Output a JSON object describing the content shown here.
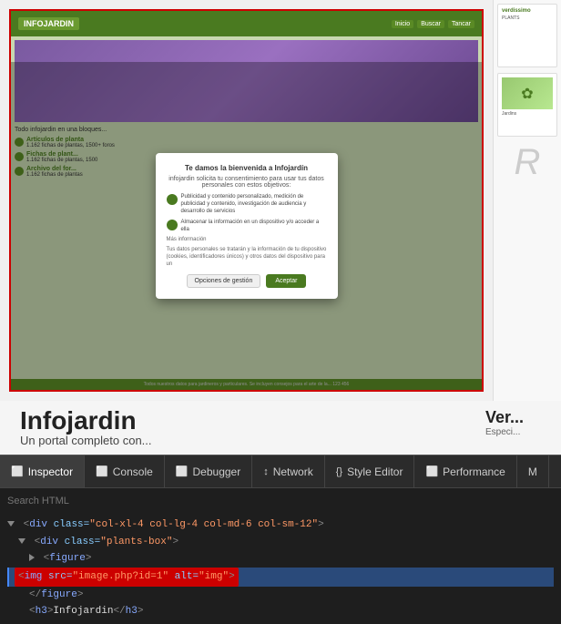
{
  "top_area": {
    "browser_frame": {
      "header": {
        "logo": "INFOJARDIN",
        "nav_items": [
          "Inicio",
          "Buscar",
          "Tancar"
        ]
      },
      "modal": {
        "title": "Te damos la bienvenida a Infojardín",
        "subtitle": "infojardin solicita tu consentimiento para usar tus datos personales con estos objetivos:",
        "option1": "Publicidad y contenido personalizado, medición de publicidad y contenido, investigación de audiencia y desarrollo de servicios",
        "option2": "Almacenar la información en un dispositivo y/o acceder a ella",
        "more_link": "Más información",
        "body_text": "Tus datos personales se tratarán y la información de tu dispositivo (cookies, identificadores únicos) y otros datos del dispositivo para un",
        "btn_manage": "Opciones de gestión",
        "btn_accept": "Aceptar"
      },
      "list_items": [
        {
          "title": "Artículos de planta",
          "text": "1.162 fichas de plantas, 1500+ foros"
        },
        {
          "title": "Fichas de plant...",
          "text": "1.162 fichas de plantas, 1500"
        },
        {
          "title": "Archivo del for...",
          "text": "1.162 fichas de plantas"
        }
      ],
      "footer_text": "Todos nuestros datos para jardineros y particulares. Se incluyen consejos para el arte de la... 123 456"
    },
    "right_preview": {
      "card1": {
        "logo": "verdissimo",
        "subtitle": "PLANTS"
      },
      "card2": {
        "logo": "Jardins",
        "flower_symbol": "✿"
      },
      "big_text": "R"
    }
  },
  "bottom_titles": {
    "left": {
      "h1": "Infojardin",
      "subtitle": "Un portal completo con..."
    },
    "right": {
      "h1": "Ver...",
      "subtitle": "Especi..."
    }
  },
  "devtools": {
    "tabs": [
      {
        "label": "Inspector",
        "icon": "⬜",
        "active": true
      },
      {
        "label": "Console",
        "icon": "⬜",
        "active": false
      },
      {
        "label": "Debugger",
        "icon": "⬜",
        "active": false
      },
      {
        "label": "Network",
        "icon": "⬜",
        "active": false
      },
      {
        "label": "Style Editor",
        "icon": "{}",
        "active": false
      },
      {
        "label": "Performance",
        "icon": "⬜",
        "active": false
      },
      {
        "label": "M",
        "icon": "⬜",
        "active": false
      }
    ],
    "search_placeholder": "Search HTML",
    "html_lines": [
      {
        "text": "▼ <div class=\"col-xl-4 col-lg-4 col-md-6 col-sm-12\">",
        "indent": 0
      },
      {
        "text": "▼ <div class=\"plants-box\">",
        "indent": 1
      },
      {
        "text": "<figure>",
        "indent": 2
      },
      {
        "text": "<img src=\"image.php?id=1\" alt=\"img\">",
        "indent": 3,
        "highlighted": true
      },
      {
        "text": "</figure>",
        "indent": 2
      },
      {
        "text": "<h3>Infojardin</h3>",
        "indent": 2
      }
    ]
  }
}
